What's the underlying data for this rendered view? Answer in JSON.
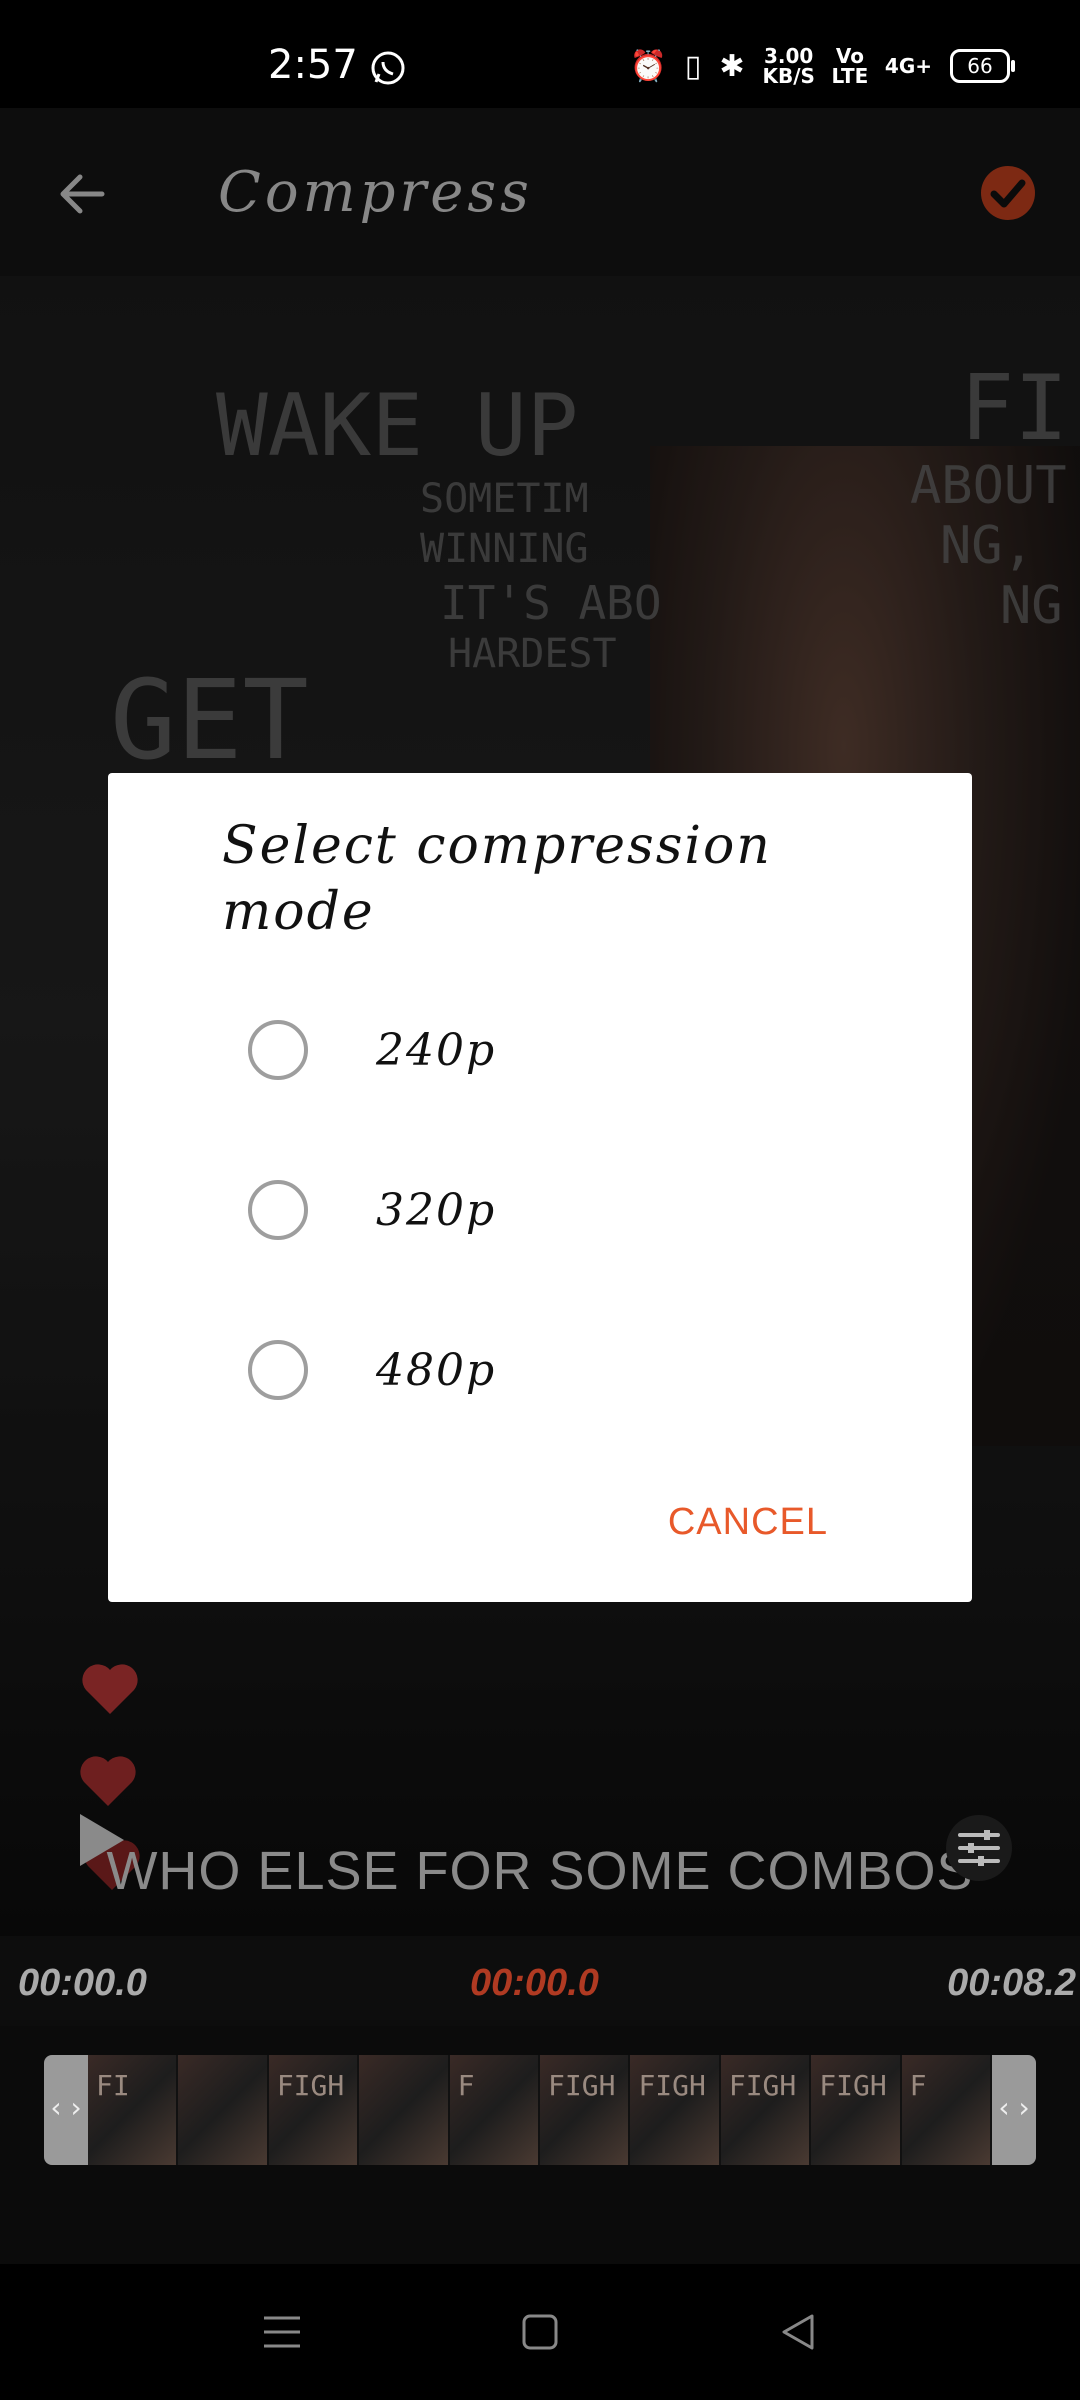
{
  "status_bar": {
    "time": "2:57",
    "net_speed_value": "3.00",
    "net_speed_unit": "KB/S",
    "volte": "Vo LTE",
    "network": "4G+",
    "battery": "66",
    "icons": [
      "whatsapp-icon",
      "alarm-icon",
      "vibrate-icon",
      "bluetooth-icon",
      "signal-icon",
      "battery-icon"
    ]
  },
  "app_bar": {
    "title": "Compress",
    "accent_color": "#e8592a"
  },
  "video": {
    "subtitle": "WHO ELSE FOR SOME COMBOS",
    "wall_text": [
      "WAKE UP",
      "SOMETIM",
      "WINNING",
      "IT'S ABO",
      "HARDEST",
      "GET",
      "FI",
      "ABOUT",
      "NG,",
      "NG"
    ]
  },
  "dialog": {
    "title": "Select compression mode",
    "options": [
      "240p",
      "320p",
      "480p"
    ],
    "cancel_label": "CANCEL"
  },
  "timeline": {
    "start_time": "00:00.0",
    "current_time": "00:00.0",
    "end_time": "00:08.2",
    "left_handle": "‹ ›",
    "right_handle": "‹ ›",
    "thumb_labels": [
      "FI",
      "",
      "FIGH",
      "",
      "F",
      "FIGH",
      "FIGH",
      "FIGH",
      "FIGH",
      "F"
    ]
  }
}
